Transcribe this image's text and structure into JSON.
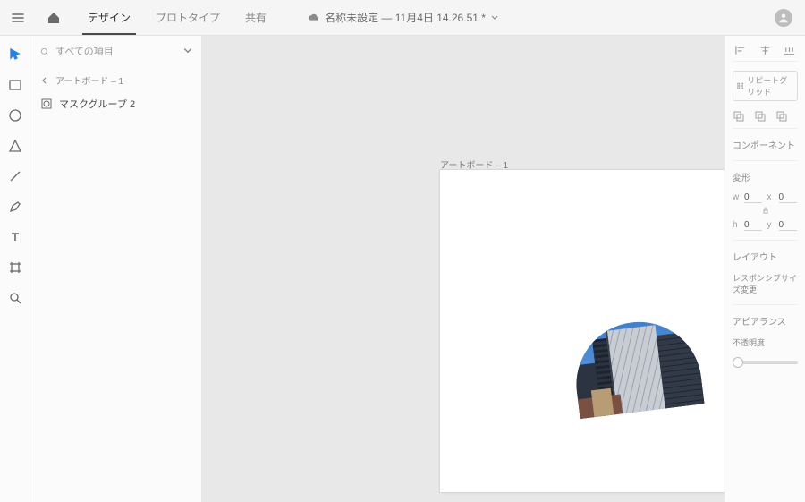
{
  "topbar": {
    "tabs": {
      "design": "デザイン",
      "prototype": "プロトタイプ",
      "share": "共有"
    },
    "doc_title": "名称未設定 — 11月4日 14.26.51 *"
  },
  "layers_panel": {
    "search_placeholder": "すべての項目",
    "breadcrumb": "アートボード – 1",
    "items": [
      {
        "label": "マスクグループ 2"
      }
    ]
  },
  "canvas": {
    "artboard_label": "アートボード – 1"
  },
  "right_panel": {
    "repeat_grid_label": "リピートグリッド",
    "section_component": "コンポーネント",
    "section_transform": "変形",
    "transform": {
      "w_label": "w",
      "w_value": "0",
      "x_label": "X",
      "x_value": "0",
      "h_label": "H",
      "h_value": "0",
      "y_label": "Y",
      "y_value": "0"
    },
    "section_layout": "レイアウト",
    "responsive_label": "レスポンシブサイズ変更",
    "section_appearance": "アピアランス",
    "opacity_label": "不透明度"
  }
}
